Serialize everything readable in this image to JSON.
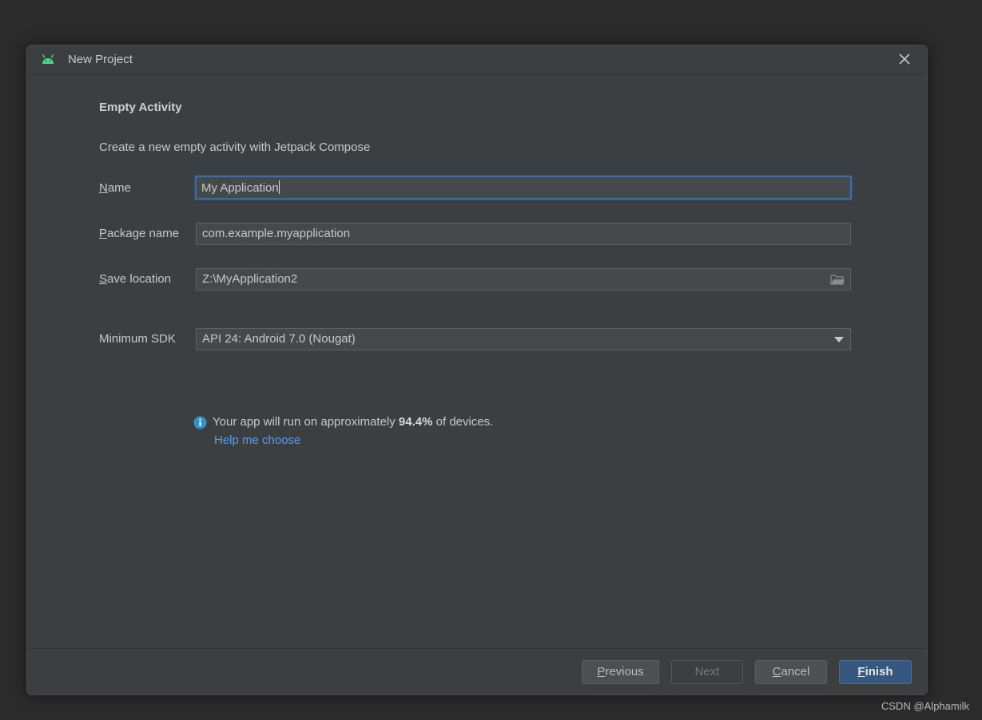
{
  "dialog": {
    "title": "New Project",
    "close_icon": "close-icon",
    "app_icon": "android-icon"
  },
  "content": {
    "heading": "Empty Activity",
    "description": "Create a new empty activity with Jetpack Compose"
  },
  "form": {
    "name": {
      "label_mnemonic": "N",
      "label_rest": "ame",
      "value": "My Application"
    },
    "package_name": {
      "label_mnemonic": "P",
      "label_rest": "ackage name",
      "value": "com.example.myapplication"
    },
    "save_location": {
      "label_mnemonic": "S",
      "label_rest": "ave location",
      "value": "Z:\\MyApplication2",
      "icon": "folder-icon"
    },
    "minimum_sdk": {
      "label": "Minimum SDK",
      "value": "API 24: Android 7.0 (Nougat)"
    }
  },
  "info": {
    "icon": "info-icon",
    "text_before": "Your app will run on approximately ",
    "percentage": "94.4%",
    "text_after": " of devices.",
    "help_link": "Help me choose"
  },
  "footer": {
    "previous": {
      "mnemonic": "P",
      "rest": "revious"
    },
    "next": "Next",
    "cancel": {
      "mnemonic": "C",
      "rest": "ancel"
    },
    "finish": {
      "mnemonic": "F",
      "rest": "inish"
    }
  },
  "watermark": "CSDN @Alphamilk",
  "colors": {
    "dialog_bg": "#3c3f41",
    "field_bg": "#45494a",
    "focus_border": "#3d6e9e",
    "link": "#589df6",
    "primary_button": "#365880",
    "android_green": "#3ddc84",
    "info_blue": "#3592c4"
  }
}
